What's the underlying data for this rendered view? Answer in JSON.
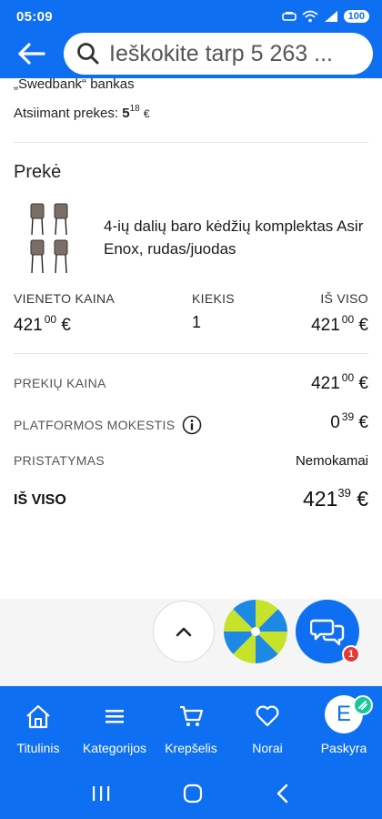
{
  "status_bar": {
    "time": "05:09",
    "battery": "100"
  },
  "search": {
    "placeholder": "Ieškokite tarp 5 263 ..."
  },
  "payment": {
    "bank_text": "„Swedbank“ bankas"
  },
  "pickup": {
    "label": "Atsiimant prekes:",
    "price_whole": "5",
    "price_cents": "18",
    "currency": "€"
  },
  "item_section": {
    "title": "Prekė",
    "product_name": "4-ių dalių baro kėdžių komplektas Asir Enox, rudas/juodas",
    "columns": {
      "unit_price_label": "VIENETO KAINA",
      "quantity_label": "KIEKIS",
      "total_label": "IŠ VISO"
    },
    "unit_price": {
      "whole": "421",
      "cents": "00",
      "currency": "€"
    },
    "quantity": "1",
    "line_total": {
      "whole": "421",
      "cents": "00",
      "currency": "€"
    }
  },
  "summary": {
    "items_price": {
      "label": "PREKIŲ KAINA",
      "whole": "421",
      "cents": "00",
      "currency": "€"
    },
    "platform_fee": {
      "label": "PLATFORMOS MOKESTIS",
      "whole": "0",
      "cents": "39",
      "currency": "€"
    },
    "delivery": {
      "label": "PRISTATYMAS",
      "value": "Nemokamai"
    },
    "grand_total": {
      "label": "IŠ VISO",
      "whole": "421",
      "cents": "39",
      "currency": "€"
    }
  },
  "chat": {
    "badge": "1"
  },
  "bottom_nav": {
    "items": [
      {
        "label": "Titulinis",
        "icon": "home-icon"
      },
      {
        "label": "Kategorijos",
        "icon": "menu-icon"
      },
      {
        "label": "Krepšelis",
        "icon": "cart-icon"
      },
      {
        "label": "Norai",
        "icon": "heart-icon"
      },
      {
        "label": "Paskyra",
        "icon": "avatar",
        "avatar_letter": "E"
      }
    ]
  },
  "colors": {
    "brand_blue": "#0f6ff2",
    "badge_red": "#e53935",
    "badge_green": "#16c79a"
  }
}
